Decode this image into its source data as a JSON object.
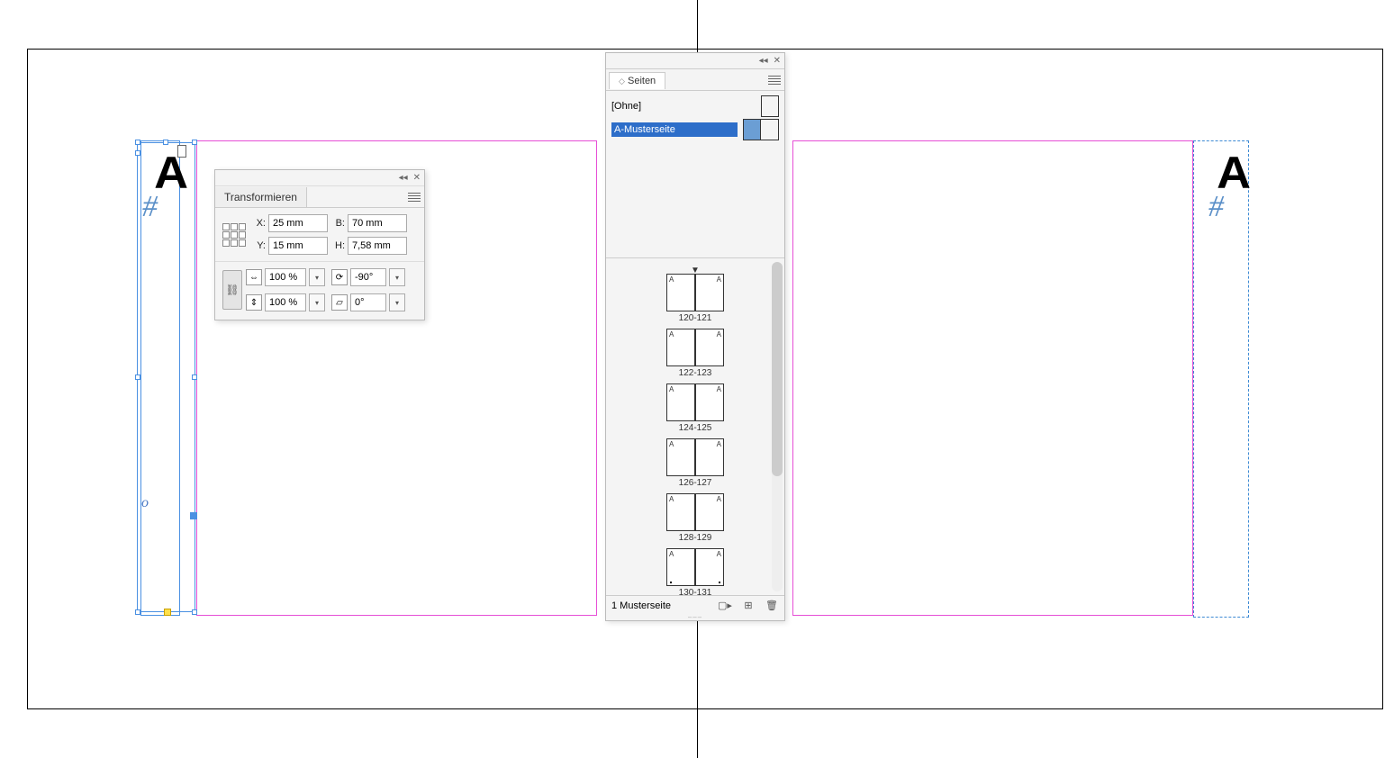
{
  "letter_left": "A",
  "letter_right": "A",
  "hash_char": "#",
  "o_char": "o",
  "transform": {
    "title": "Transformieren",
    "labels": {
      "x": "X:",
      "y": "Y:",
      "w": "B:",
      "h": "H:"
    },
    "x": "25 mm",
    "y": "15 mm",
    "w": "70 mm",
    "h": "7,58 mm",
    "scale_x": "100 %",
    "scale_y": "100 %",
    "rotate": "-90°",
    "shear": "0°"
  },
  "pages": {
    "title": "Seiten",
    "none_label": "[Ohne]",
    "master_label": "A-Musterseite",
    "footer_label": "1 Musterseite",
    "spreads": [
      {
        "label": "120-121"
      },
      {
        "label": "122-123"
      },
      {
        "label": "124-125"
      },
      {
        "label": "126-127"
      },
      {
        "label": "128-129"
      },
      {
        "label": "130-131"
      }
    ]
  }
}
